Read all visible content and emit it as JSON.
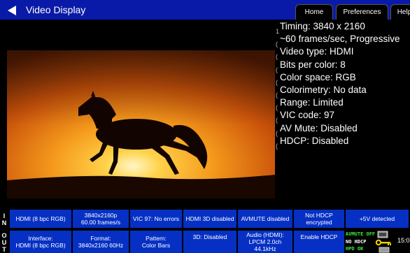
{
  "header": {
    "title": "Video Display",
    "tabs": [
      "Home",
      "Preferences",
      "Help"
    ]
  },
  "info_lines": [
    "Timing: 3840 x 2160",
    "~60 frames/sec, Progressive",
    "Video type: HDMI",
    "Bits per color: 8",
    "Color space: RGB",
    "Colorimetry: No data",
    "Range: Limited",
    "VIC code: 97",
    "AV Mute: Disabled",
    "HDCP: Disabled"
  ],
  "info_marks": [
    "1",
    "(",
    "(",
    "(",
    "(",
    "(",
    "(",
    "(",
    "(",
    "("
  ],
  "status_row": {
    "side": [
      "I",
      "N"
    ],
    "cells": [
      [
        "HDMI (8 bpc RGB)"
      ],
      [
        "3840x2160p",
        "60.00 frames/s"
      ],
      [
        "VIC 97: No errors"
      ],
      [
        "HDMI 3D disabled"
      ],
      [
        "AVMUTE disabled"
      ],
      [
        "Not HDCP",
        "encrypted"
      ],
      [
        "+5V detected"
      ]
    ]
  },
  "control_row": {
    "side": [
      "O",
      "U",
      "T"
    ],
    "cells": [
      [
        "Interface:",
        "HDMI (8 bpc RGB)"
      ],
      [
        "Format:",
        "3840x2160 60Hz"
      ],
      [
        "Pattern:",
        "Color Bars"
      ],
      [
        "3D: Disabled"
      ],
      [
        "Audio (HDMI):",
        "LPCM 2.0ch",
        "44.1kHz"
      ],
      [
        "Enable HDCP"
      ]
    ]
  },
  "avmute_status": {
    "line1": "AVMUTE OFF",
    "line2": "NO HDCP",
    "line3": "HPD OK"
  },
  "clock": "15:0",
  "colors": {
    "accent": "#0630c4",
    "topbar": "#0a1aa8",
    "status_green": "#3df03d",
    "status_white": "#ffffff"
  }
}
